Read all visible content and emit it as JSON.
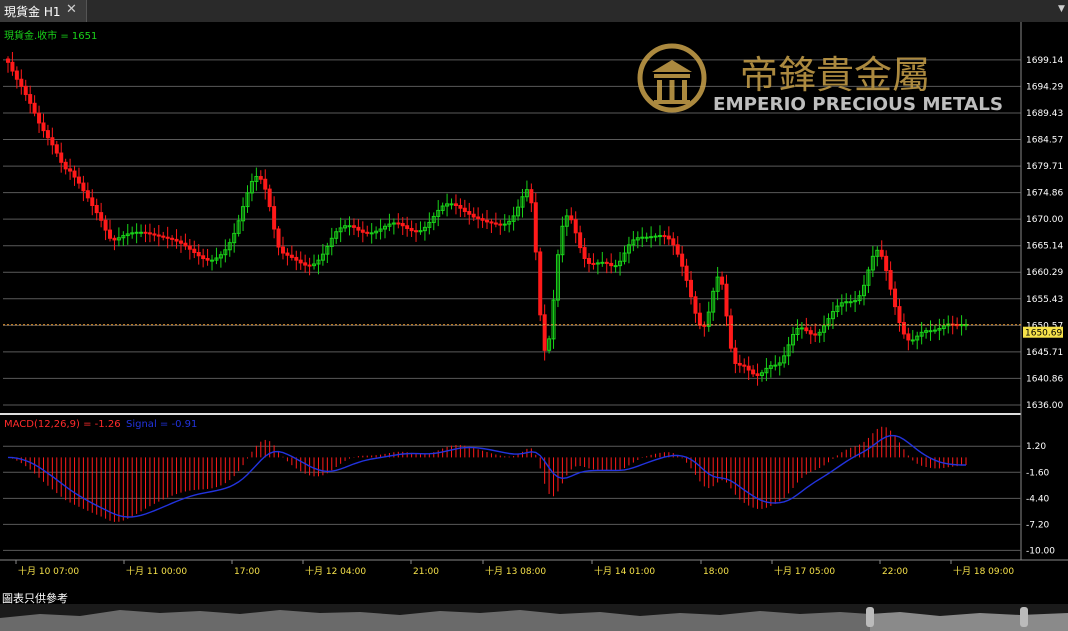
{
  "tab": {
    "title": "現貨金 H1",
    "close_glyph": "✕",
    "menu_glyph": "▼"
  },
  "price_panel": {
    "legend": "現貨金.收市 = 1651"
  },
  "macd_panel": {
    "legend_macd": "MACD(12,26,9) = -1.26",
    "legend_signal": "Signal = -0.91"
  },
  "brand": {
    "chinese": "帝鋒貴金屬",
    "english": "EMPERIO PRECIOUS METALS",
    "logo_icon": "emperio-pillar-logo"
  },
  "footer": {
    "disclaimer": "圖表只供參考"
  },
  "colors": {
    "up": "#19d219",
    "down": "#ff1a1a",
    "signal": "#2233dd",
    "last_price_bg": "#f5e14a",
    "gold": "#c9a24a"
  },
  "chart_data": [
    {
      "type": "candlestick",
      "title": "",
      "y_ticks": [
        "1699.14",
        "1694.29",
        "1689.43",
        "1684.57",
        "1679.71",
        "1674.86",
        "1670.00",
        "1665.14",
        "1660.29",
        "1655.43",
        "1650.57",
        "1645.71",
        "1640.86",
        "1636.00"
      ],
      "ylim": [
        1636.0,
        1701.5
      ],
      "last_price_label": "1650.69",
      "last_price": 1650.69,
      "x_tick_labels": [
        "十月 10 07:00",
        "十月 11 00:00",
        "17:00",
        "十月 12 04:00",
        "21:00",
        "十月 13 08:00",
        "十月 14 01:00",
        "18:00",
        "十月 17 05:00",
        "22:00",
        "十月 18 09:00"
      ],
      "close": [
        1698.7,
        1697.1,
        1695.6,
        1694.3,
        1692.8,
        1691.2,
        1689.4,
        1687.6,
        1686.2,
        1684.9,
        1683.6,
        1682.1,
        1680.4,
        1679.2,
        1678.8,
        1677.7,
        1676.6,
        1675.2,
        1673.9,
        1672.5,
        1671.2,
        1669.8,
        1668.0,
        1666.5,
        1666.2,
        1666.6,
        1667.0,
        1667.3,
        1667.5,
        1667.6,
        1667.6,
        1667.5,
        1667.3,
        1667.1,
        1666.9,
        1666.7,
        1666.5,
        1666.3,
        1666.0,
        1665.6,
        1665.1,
        1664.5,
        1663.9,
        1663.3,
        1662.8,
        1662.5,
        1662.5,
        1662.9,
        1663.5,
        1664.4,
        1665.7,
        1667.4,
        1669.7,
        1672.3,
        1674.8,
        1676.9,
        1677.8,
        1677.3,
        1675.5,
        1672.3,
        1668.2,
        1664.9,
        1663.8,
        1663.4,
        1663.0,
        1662.5,
        1662.0,
        1661.6,
        1661.5,
        1661.8,
        1662.5,
        1663.6,
        1665.0,
        1666.5,
        1667.7,
        1668.4,
        1668.8,
        1668.8,
        1668.5,
        1668.0,
        1667.6,
        1667.4,
        1667.5,
        1667.8,
        1668.2,
        1668.7,
        1669.1,
        1669.3,
        1669.2,
        1668.8,
        1668.3,
        1667.9,
        1667.7,
        1667.9,
        1668.5,
        1669.4,
        1670.5,
        1671.6,
        1672.4,
        1672.8,
        1672.8,
        1672.5,
        1672.0,
        1671.4,
        1670.9,
        1670.4,
        1670.1,
        1669.8,
        1669.5,
        1669.3,
        1669.1,
        1669.0,
        1669.1,
        1669.6,
        1670.6,
        1672.2,
        1674.1,
        1675.4,
        1673.0,
        1664.0,
        1652.5,
        1646.0,
        1648.1,
        1655.2,
        1663.5,
        1668.7,
        1670.6,
        1669.9,
        1667.5,
        1664.8,
        1662.8,
        1661.9,
        1661.8,
        1662.0,
        1662.1,
        1661.9,
        1661.5,
        1661.5,
        1662.3,
        1663.8,
        1665.3,
        1666.2,
        1666.6,
        1666.7,
        1666.7,
        1666.8,
        1666.9,
        1667.0,
        1666.9,
        1666.4,
        1665.3,
        1663.6,
        1661.4,
        1658.8,
        1655.8,
        1652.8,
        1650.6,
        1650.4,
        1653.0,
        1656.8,
        1659.4,
        1658.1,
        1652.3,
        1646.4,
        1643.6,
        1643.3,
        1643.1,
        1642.4,
        1641.7,
        1641.4,
        1641.9,
        1642.7,
        1643.2,
        1643.3,
        1643.7,
        1645.0,
        1647.0,
        1648.9,
        1650.0,
        1650.1,
        1649.6,
        1649.0,
        1648.8,
        1649.3,
        1650.5,
        1651.8,
        1653.1,
        1654.1,
        1654.7,
        1654.9,
        1654.9,
        1655.1,
        1656.0,
        1657.9,
        1660.7,
        1663.2,
        1664.3,
        1663.2,
        1660.6,
        1657.2,
        1654.0,
        1651.1,
        1649.0,
        1647.9,
        1647.9,
        1648.6,
        1649.3,
        1649.6,
        1649.6,
        1649.7,
        1650.0,
        1650.5,
        1650.8,
        1650.7,
        1650.6,
        1650.7,
        1650.7
      ]
    },
    {
      "type": "macd",
      "params": "12,26,9",
      "macd_value": -1.26,
      "signal_value": -0.91,
      "y_ticks": [
        "1.20",
        "-1.60",
        "-4.40",
        "-7.20",
        "-10.00"
      ],
      "ylim": [
        -10.6,
        2.3
      ]
    }
  ]
}
